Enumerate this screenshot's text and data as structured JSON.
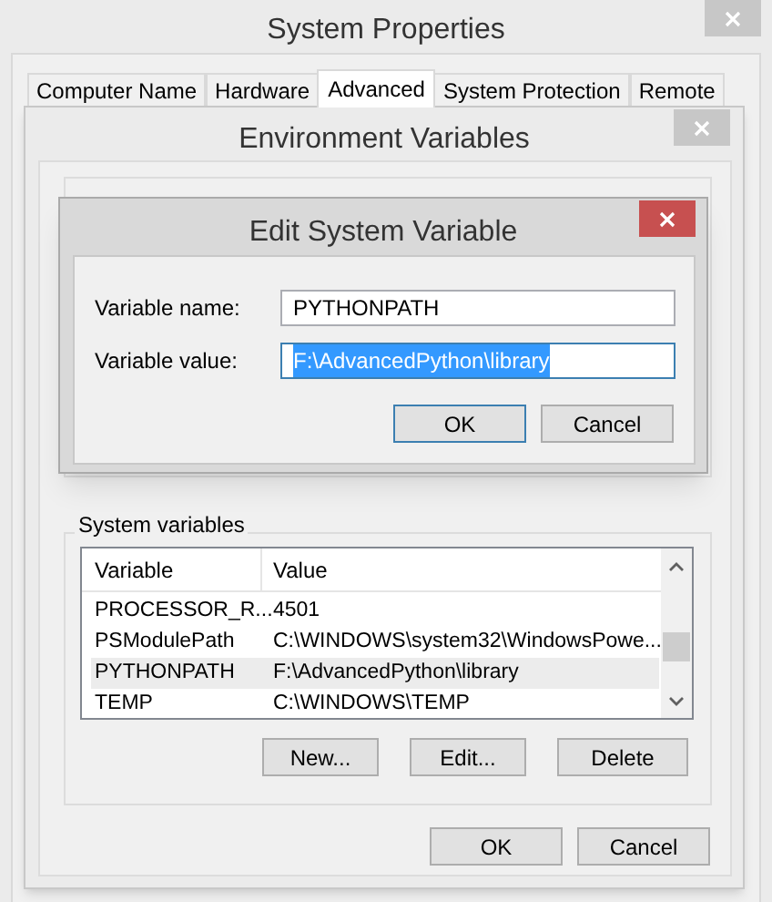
{
  "system_properties": {
    "title": "System Properties",
    "tabs": [
      {
        "label": "Computer Name",
        "selected": false
      },
      {
        "label": "Hardware",
        "selected": false
      },
      {
        "label": "Advanced",
        "selected": true
      },
      {
        "label": "System Protection",
        "selected": false
      },
      {
        "label": "Remote",
        "selected": false
      }
    ]
  },
  "environment_variables": {
    "title": "Environment Variables",
    "system_variables": {
      "label": "System variables",
      "columns": [
        "Variable",
        "Value"
      ],
      "rows": [
        {
          "variable": "PROCESSOR_R...",
          "value": "4501",
          "selected": false
        },
        {
          "variable": "PSModulePath",
          "value": "C:\\WINDOWS\\system32\\WindowsPowe...",
          "selected": false
        },
        {
          "variable": "PYTHONPATH",
          "value": "F:\\AdvancedPython\\library",
          "selected": true
        },
        {
          "variable": "TEMP",
          "value": "C:\\WINDOWS\\TEMP",
          "selected": false
        }
      ]
    },
    "list_buttons": [
      "New...",
      "Edit...",
      "Delete"
    ],
    "buttons": [
      "OK",
      "Cancel"
    ]
  },
  "edit_dialog": {
    "title": "Edit System Variable",
    "fields": [
      {
        "label": "Variable name:",
        "value": "PYTHONPATH",
        "focused": false
      },
      {
        "label": "Variable value:",
        "value": "F:\\AdvancedPython\\library",
        "focused": true
      }
    ],
    "buttons": [
      {
        "label": "OK",
        "default": true
      },
      {
        "label": "Cancel",
        "default": false
      }
    ]
  }
}
